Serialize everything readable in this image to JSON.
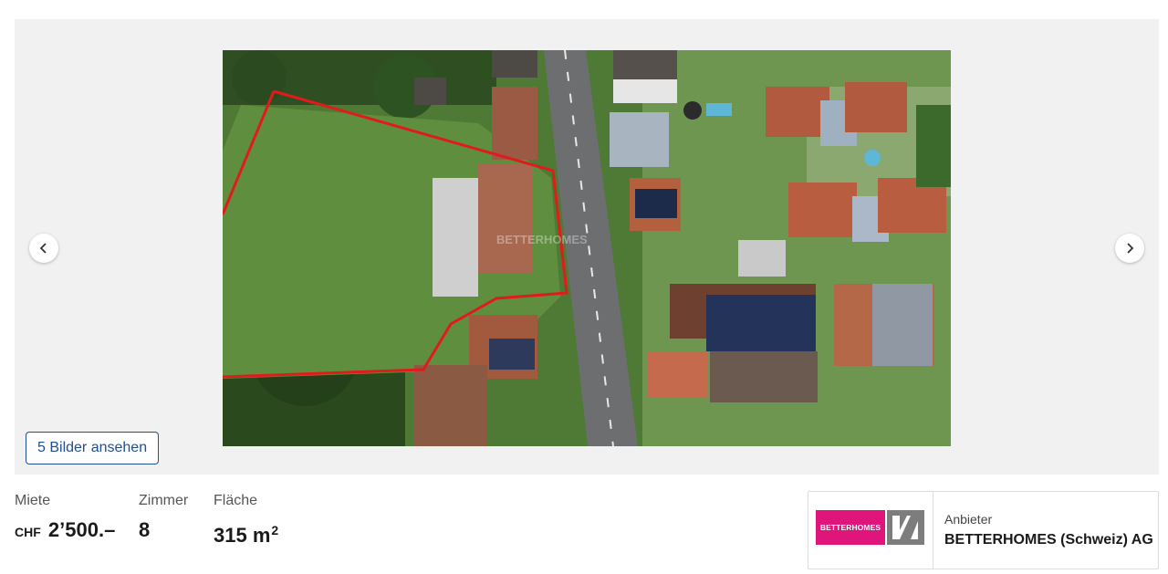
{
  "gallery": {
    "view_images_label": "5 Bilder ansehen",
    "watermark": "BETTERHOMES",
    "prev_icon": "chevron-left-icon",
    "next_icon": "chevron-right-icon"
  },
  "facts": {
    "rent": {
      "label": "Miete",
      "currency": "CHF",
      "value": "2’500.–"
    },
    "rooms": {
      "label": "Zimmer",
      "value": "8"
    },
    "area": {
      "label": "Fläche",
      "value": "315 m",
      "unit_exponent": "2"
    }
  },
  "provider": {
    "label": "Anbieter",
    "name": "BETTERHOMES (Schweiz) AG",
    "logo_text": "BETTERHOMES",
    "brand_color": "#e0157b"
  }
}
